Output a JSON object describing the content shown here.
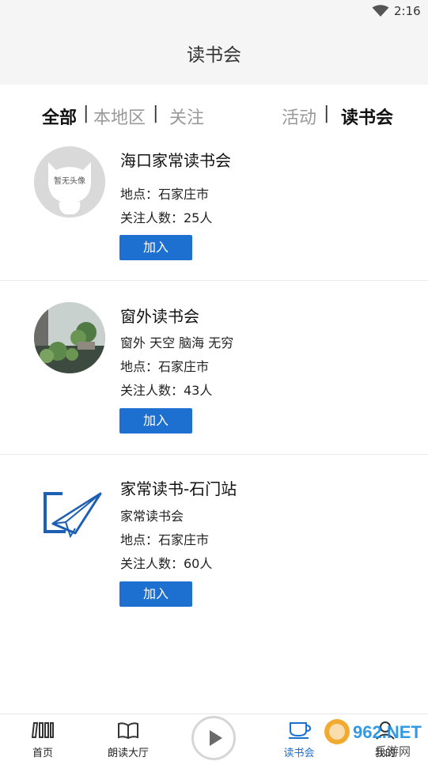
{
  "status_bar": {
    "time": "2:16",
    "wifi_icon": "wifi-icon"
  },
  "app_bar": {
    "title": "读书会"
  },
  "filters": {
    "all": "全部",
    "local": "本地区",
    "follow": "关注",
    "activity": "活动",
    "clubs": "读书会",
    "separator": "|"
  },
  "clubs": [
    {
      "name": "海口家常读书会",
      "description": "",
      "location": "地点：石家庄市",
      "followers": "关注人数：25人",
      "join_label": "加入",
      "avatar": "placeholder-cat-avatar",
      "avatar_text": "暂无头像"
    },
    {
      "name": "窗外读书会",
      "description": "窗外 天空 脑海 无穷",
      "location": "地点：石家庄市",
      "followers": "关注人数：43人",
      "join_label": "加入",
      "avatar": "window-plants-photo"
    },
    {
      "name": "家常读书-石门站",
      "description": "家常读书会",
      "location": "地点：石家庄市",
      "followers": "关注人数：60人",
      "join_label": "加入",
      "avatar": "paper-plane-logo"
    }
  ],
  "tab_bar": {
    "items": [
      {
        "label": "首页",
        "icon": "bookshelf-icon"
      },
      {
        "label": "朗读大厅",
        "icon": "open-book-icon"
      },
      {
        "label": "",
        "icon": "play-icon"
      },
      {
        "label": "读书会",
        "icon": "cup-icon",
        "active": true
      },
      {
        "label": "我的",
        "icon": "user-icon"
      }
    ]
  },
  "watermark": {
    "brand": "962.NET",
    "sub": "乐游网"
  },
  "colors": {
    "accent": "#1d6fd0",
    "header_bg": "#f5f5f5",
    "inactive_text": "#9a9a9a"
  }
}
